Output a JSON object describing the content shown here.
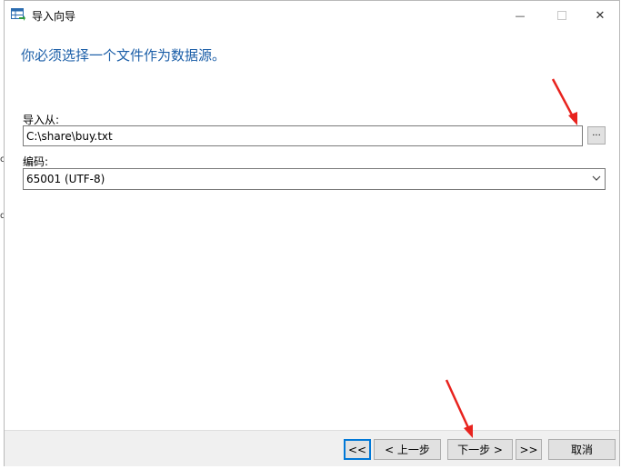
{
  "background": {
    "left_fragments": [
      "c",
      "d"
    ]
  },
  "window": {
    "title": "导入向导",
    "minimize_glyph": "—",
    "close_glyph": "✕"
  },
  "header": {
    "heading": "你必须选择一个文件作为数据源。"
  },
  "form": {
    "import_from_label": "导入从:",
    "import_from_value": "C:\\share\\buy.txt",
    "browse_label": "...",
    "encoding_label": "编码:",
    "encoding_value": "65001 (UTF-8)"
  },
  "footer": {
    "first_label": "<<",
    "prev_label": "< 上一步",
    "next_label": "下一步 >",
    "last_label": ">>",
    "cancel_label": "取消"
  },
  "annotations": {
    "arrow_color": "#e8231e"
  },
  "colors": {
    "heading": "#1c5fa8",
    "focus_border": "#0078d7",
    "footer_bg": "#f0f0f0"
  }
}
